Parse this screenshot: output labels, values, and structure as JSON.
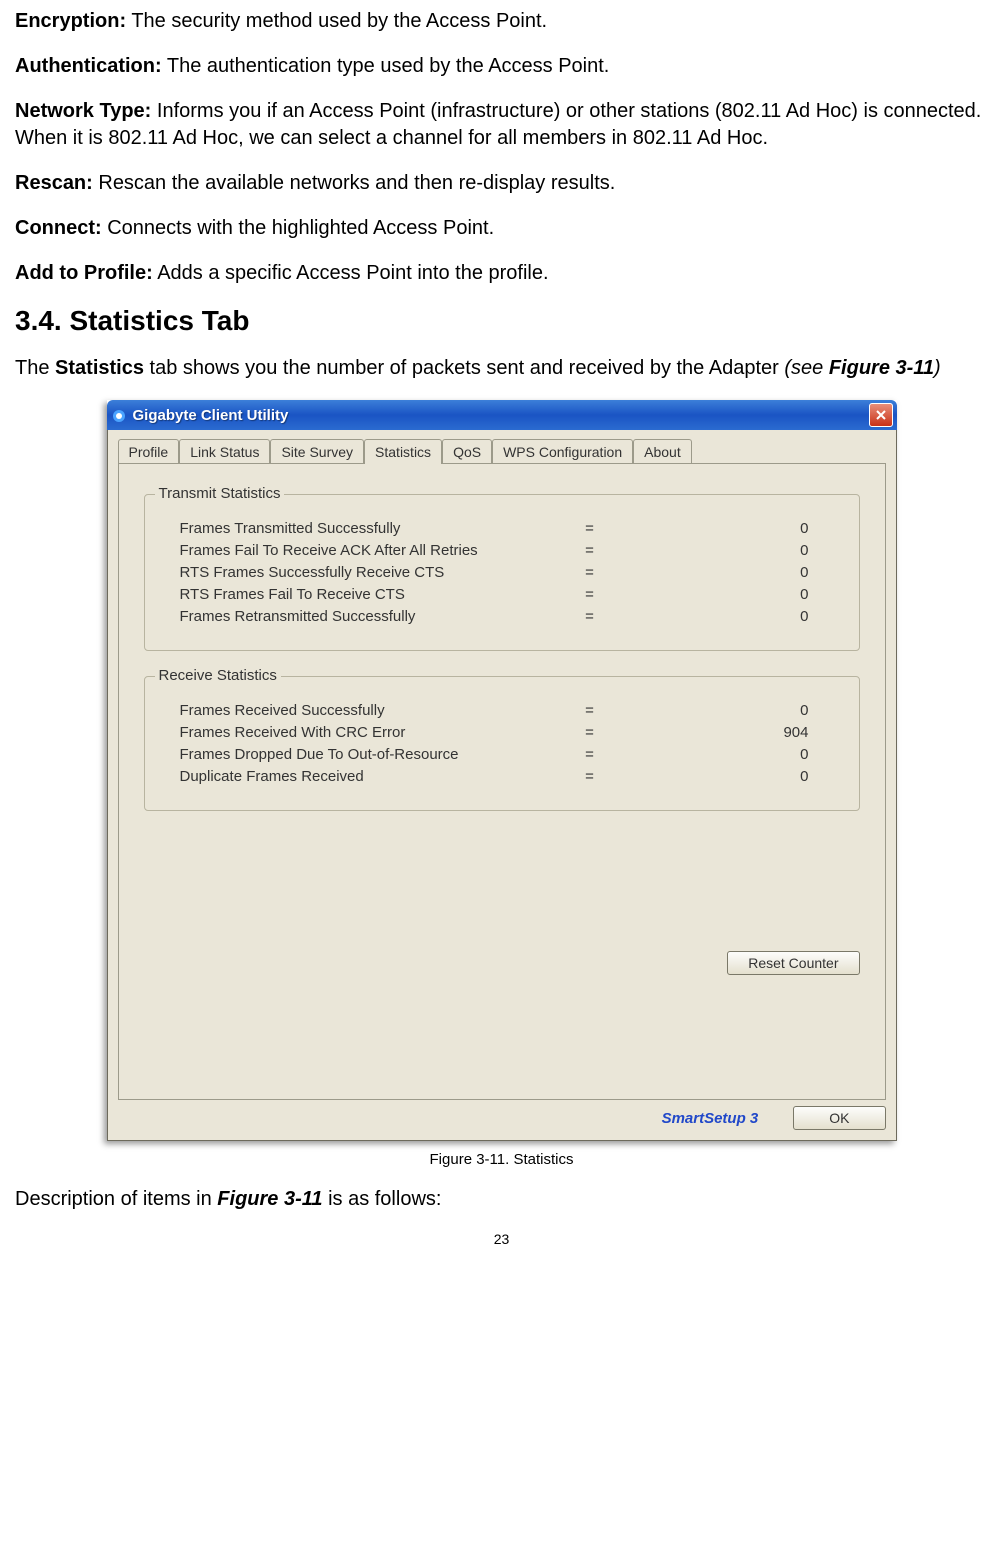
{
  "defs": [
    {
      "term": "Encryption:",
      "desc": " The security method used by the Access Point."
    },
    {
      "term": "Authentication:",
      "desc": " The authentication type used by the Access Point."
    },
    {
      "term": "Network Type:",
      "desc": " Informs you if an Access Point (infrastructure) or other stations (802.11 Ad Hoc) is connected. When it is 802.11 Ad Hoc, we can select a channel for all members in 802.11 Ad Hoc."
    },
    {
      "term": "Rescan:",
      "desc": " Rescan the available networks and then re-display results."
    },
    {
      "term": "Connect:",
      "desc": " Connects with the highlighted Access Point."
    },
    {
      "term": "Add to Profile:",
      "desc": " Adds a specific Access Point into the profile."
    }
  ],
  "heading": "3.4. Statistics Tab",
  "intro": {
    "pre": "The ",
    "bold": "Statistics",
    "mid": " tab shows you the number of packets sent and received by the Adapter ",
    "see_open": "(see ",
    "figref": "Figure 3-11",
    "see_close": ")"
  },
  "win": {
    "title": "Gigabyte Client Utility",
    "tabs": [
      "Profile",
      "Link Status",
      "Site Survey",
      "Statistics",
      "QoS",
      "WPS Configuration",
      "About"
    ],
    "active_tab": 3,
    "tx_title": "Transmit Statistics",
    "tx_rows": [
      {
        "label": "Frames Transmitted Successfully",
        "val": "0"
      },
      {
        "label": "Frames Fail To Receive ACK After All Retries",
        "val": "0"
      },
      {
        "label": "RTS Frames Successfully Receive CTS",
        "val": "0"
      },
      {
        "label": "RTS Frames Fail To Receive CTS",
        "val": "0"
      },
      {
        "label": "Frames Retransmitted Successfully",
        "val": "0"
      }
    ],
    "rx_title": "Receive Statistics",
    "rx_rows": [
      {
        "label": "Frames Received Successfully",
        "val": "0"
      },
      {
        "label": "Frames Received With CRC Error",
        "val": "904"
      },
      {
        "label": "Frames Dropped Due To Out-of-Resource",
        "val": "0"
      },
      {
        "label": "Duplicate Frames Received",
        "val": "0"
      }
    ],
    "reset_btn": "Reset Counter",
    "smartsetup": "SmartSetup 3",
    "ok_btn": "OK"
  },
  "caption": "Figure 3-11.    Statistics",
  "desc_line": {
    "pre": "Description of items in ",
    "fig": "Figure 3-11",
    "post": " is as follows:"
  },
  "pagenum": "23"
}
